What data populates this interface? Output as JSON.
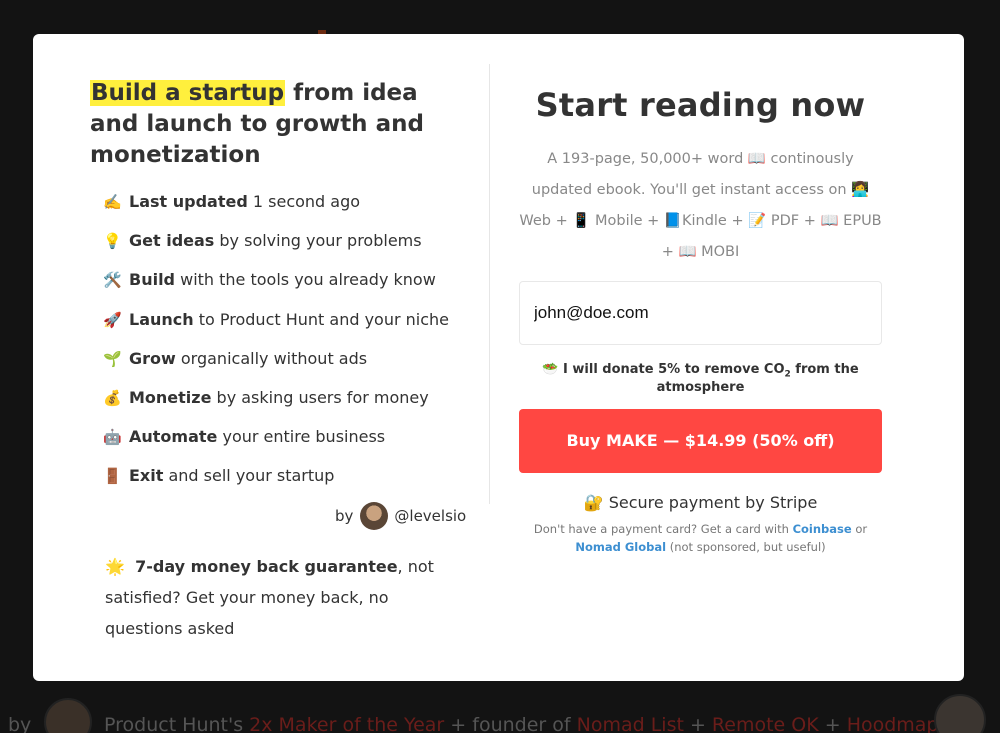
{
  "headline": {
    "highlight": "Build a startup",
    "rest": " from idea and launch to growth and monetization"
  },
  "features": [
    {
      "icon": "writing-hand-icon",
      "glyph": "✍️",
      "bold": "Last updated",
      "text": " 1 second ago"
    },
    {
      "icon": "light-bulb-icon",
      "glyph": "💡",
      "bold": "Get ideas",
      "text": " by solving your problems"
    },
    {
      "icon": "tools-icon",
      "glyph": "🛠️",
      "bold": "Build",
      "text": " with the tools you already know"
    },
    {
      "icon": "rocket-icon",
      "glyph": "🚀",
      "bold": "Launch",
      "text": " to Product Hunt and your niche"
    },
    {
      "icon": "seedling-icon",
      "glyph": "🌱",
      "bold": "Grow",
      "text": " organically without ads"
    },
    {
      "icon": "money-bag-icon",
      "glyph": "💰",
      "bold": "Monetize",
      "text": " by asking users for money"
    },
    {
      "icon": "robot-icon",
      "glyph": "🤖",
      "bold": "Automate",
      "text": " your entire business"
    },
    {
      "icon": "door-icon",
      "glyph": "🚪",
      "bold": "Exit",
      "text": " and sell your startup"
    }
  ],
  "byline": {
    "prefix": "by",
    "handle": "@levelsio"
  },
  "guarantee": {
    "glyph": "🌟",
    "bold": "7-day money back guarantee",
    "text": ", not satisfied? Get your money back, no questions asked"
  },
  "checkout": {
    "title": "Start reading now",
    "description": "A 193-page, 50,000+ word 📖  continously updated ebook. You'll get instant access on 👩‍💻 Web + 📱 Mobile + 📘Kindle + 📝 PDF + 📖 EPUB + 📖 MOBI",
    "email_value": "john@doe.com",
    "donate_glyph": "🥗",
    "donate_text": "I will donate 5% to remove CO",
    "donate_sub": "2",
    "donate_tail": " from the atmosphere",
    "buy_label": "Buy MAKE — $14.99 (50% off)",
    "secure_glyph": "🔐",
    "secure_text": "Secure payment by Stripe",
    "note_prefix": "Don't have a payment card? Get a card with ",
    "note_link1": "Coinbase",
    "note_mid": " or ",
    "note_link2": "Nomad Global",
    "note_suffix": " (not sponsored, but useful)"
  },
  "background_footer": {
    "by": "by",
    "text1": "Product Hunt's ",
    "hl1": "2x Maker of the Year",
    "text2": " + founder of ",
    "hl2": "Nomad List",
    "text3": " + ",
    "hl3": "Remote OK",
    "text4": " + ",
    "hl4": "Hoodmaps"
  },
  "colors": {
    "accent_red": "#ff4742",
    "highlight_yellow": "#ffef3d",
    "link_blue": "#3d8fd1"
  }
}
